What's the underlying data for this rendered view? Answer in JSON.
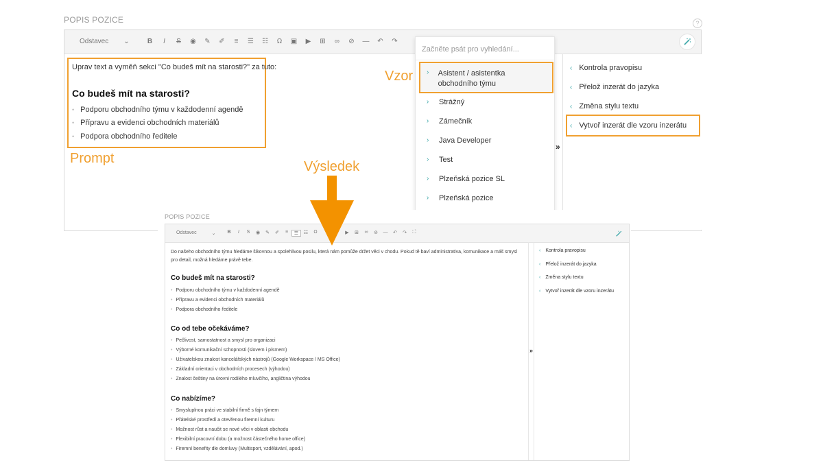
{
  "top": {
    "section_label": "POPIS POZICE",
    "help_glyph": "?",
    "toolbar": {
      "style_select": "Odstavec"
    },
    "prompt": {
      "instruction": "Uprav text a vyměň sekci \"Co budeš mít na starosti?\" za tuto:",
      "heading": "Co budeš mít na starosti?",
      "bullets": [
        "Podporu obchodního týmu v každodenní agendě",
        "Přípravu a evidenci obchodních materiálů",
        "Podpora obchodního ředitele"
      ]
    },
    "dropdown": {
      "search_placeholder": "Začněte psát pro vyhledání...",
      "items": [
        "Asistent / asistentka obchodního týmu",
        "Strážný",
        "Zámečník",
        "Java Developer",
        "Test",
        "Plzeňská pozice SL",
        "Plzeňská pozice"
      ]
    },
    "collapse_glyph": "»",
    "side_menu": [
      "Kontrola pravopisu",
      "Přelož inzerát do jazyka",
      "Změna stylu textu",
      "Vytvoř inzerát dle vzoru inzerátu"
    ]
  },
  "annotations": {
    "prompt": "Prompt",
    "vzor": "Vzor",
    "vysledek": "Výsledek",
    "accent_color": "#f0a030",
    "arrow_color": "#f39200"
  },
  "bottom": {
    "section_label": "POPIS POZICE",
    "toolbar": {
      "style_select": "Odstavec"
    },
    "intro": "Do našeho obchodního týmu hledáme šikovnou a spolehlivou posilu, která nám pomůže držet věci v chodu. Pokud tě baví administrativa, komunikace a máš smysl pro detail, možná hledáme právě tebe.",
    "sections": [
      {
        "heading": "Co budeš mít na starosti?",
        "bullets": [
          "Podporu obchodního týmu v každodenní agendě",
          "Přípravu a evidenci obchodních materiálů",
          "Podpora obchodního ředitele"
        ]
      },
      {
        "heading": "Co od tebe očekáváme?",
        "bullets": [
          "Pečlivost, samostatnost a smysl pro organizaci",
          "Výborné komunikační schopnosti (slovem i písmem)",
          "Uživatelskou znalost kancelářských nástrojů (Google Workspace / MS Office)",
          "Základní orientaci v obchodních procesech (výhodou)",
          "Znalost češtiny na úrovni rodilého mluvčího, angličtina výhodou"
        ]
      },
      {
        "heading": "Co nabízíme?",
        "bullets": [
          "Smysluplnou práci ve stabilní firmě s fajn týmem",
          "Přátelské prostředí a otevřenou firemní kulturu",
          "Možnost růst a naučit se nové věci v oblasti obchodu",
          "Flexibilní pracovní dobu (a možnost částečného home office)",
          "Firemní benefity dle domluvy (Multisport, vzdělávání, apod.)"
        ]
      }
    ],
    "collapse_glyph": "»",
    "side_menu": [
      "Kontrola pravopisu",
      "Přelož inzerát do jazyka",
      "Změna stylu textu",
      "Vytvoř inzerát dle vzoru inzerátu"
    ]
  }
}
